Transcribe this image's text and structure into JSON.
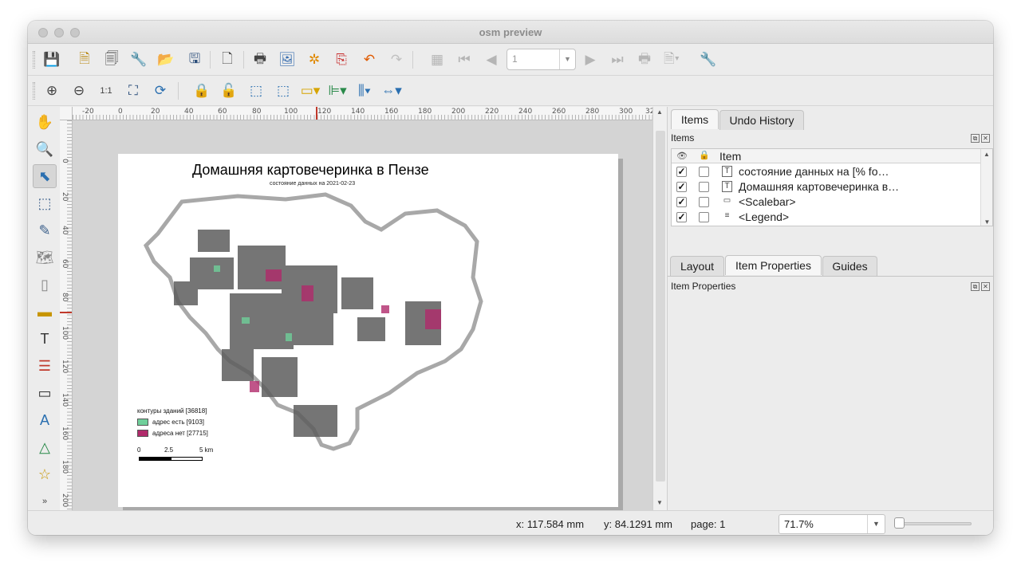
{
  "window": {
    "title": "osm preview"
  },
  "toolbar1": {
    "page_input_value": "1",
    "icons": [
      "save-icon",
      "new-layout-icon",
      "duplicate-layout-icon",
      "layout-manager-icon",
      "open-template-icon",
      "save-template-icon",
      "new-page-icon",
      "print-icon",
      "export-image-icon",
      "export-svg-icon",
      "export-pdf-icon",
      "undo-icon",
      "redo-icon",
      "atlas-preview-icon",
      "first-feature-icon",
      "previous-feature-icon",
      "next-feature-icon",
      "last-feature-icon",
      "print-atlas-icon",
      "export-atlas-icon",
      "atlas-settings-icon"
    ]
  },
  "toolbar2": {
    "icons": [
      "zoom-in-icon",
      "zoom-out-icon",
      "zoom-actual-icon",
      "zoom-full-icon",
      "refresh-icon",
      "lock-icon",
      "unlock-icon",
      "group-icon",
      "ungroup-icon",
      "raise-icon",
      "align-icon",
      "distribute-icon",
      "resize-icon"
    ]
  },
  "rulers": {
    "top": [
      "-20",
      "0",
      "20",
      "40",
      "60",
      "80",
      "100",
      "120",
      "140",
      "160",
      "180",
      "200",
      "220",
      "240",
      "260",
      "280",
      "300",
      "32"
    ],
    "left": [
      "0",
      "20",
      "40",
      "60",
      "80",
      "100",
      "120",
      "140",
      "160",
      "180",
      "200"
    ]
  },
  "map": {
    "title": "Домашняя картовечеринка в Пензе",
    "subtitle": "состояние данных на 2021-02-23",
    "legend_title": "контуры зданий [36818]",
    "legend_items": [
      {
        "label": "адрес есть [9103]",
        "color": "#6fcf9a"
      },
      {
        "label": "адреса нет [27715]",
        "color": "#b02a6b"
      }
    ],
    "scale_labels": [
      "0",
      "2.5",
      "5 km"
    ]
  },
  "right_panel": {
    "top_tabs": [
      "Items",
      "Undo History"
    ],
    "items_header": "Items",
    "columns": {
      "item": "Item"
    },
    "items": [
      {
        "visible": true,
        "locked": false,
        "label": "состояние данных на [% fo…",
        "icon": "T"
      },
      {
        "visible": true,
        "locked": false,
        "label": "Домашняя картовечеринка в…",
        "icon": "T"
      },
      {
        "visible": true,
        "locked": false,
        "label": "<Scalebar>",
        "icon": "▭"
      },
      {
        "visible": true,
        "locked": false,
        "label": "<Legend>",
        "icon": "≡"
      }
    ],
    "bottom_tabs": [
      "Layout",
      "Item Properties",
      "Guides"
    ],
    "props_header": "Item Properties"
  },
  "status": {
    "x": "x: 117.584 mm",
    "y": "y: 84.1291 mm",
    "page": "page: 1",
    "zoom": "71.7%"
  }
}
